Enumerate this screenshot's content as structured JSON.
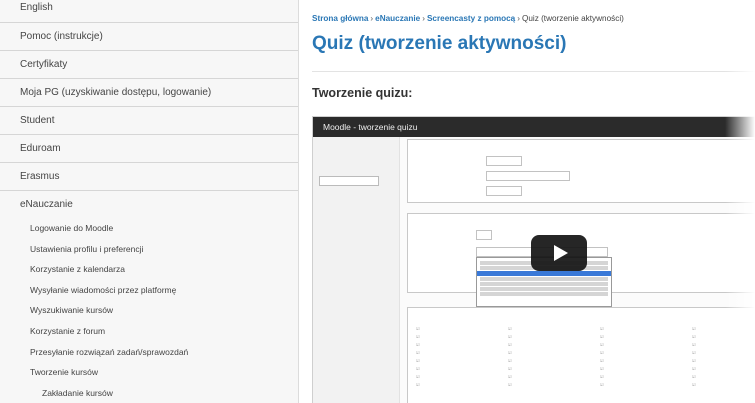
{
  "sidebar": {
    "items": [
      {
        "label": "English"
      },
      {
        "label": "Pomoc (instrukcje)"
      },
      {
        "label": "Certyfikaty"
      },
      {
        "label": "Moja PG (uzyskiwanie dostępu, logowanie)"
      },
      {
        "label": "Student"
      },
      {
        "label": "Eduroam"
      },
      {
        "label": "Erasmus"
      },
      {
        "label": "eNauczanie"
      }
    ],
    "subitems": [
      {
        "label": "Logowanie do Moodle"
      },
      {
        "label": "Ustawienia profilu i preferencji"
      },
      {
        "label": "Korzystanie z kalendarza"
      },
      {
        "label": "Wysyłanie wiadomości przez platformę"
      },
      {
        "label": "Wyszukiwanie kursów"
      },
      {
        "label": "Korzystanie z forum"
      },
      {
        "label": "Przesyłanie rozwiązań zadań/sprawozdań"
      },
      {
        "label": "Tworzenie kursów"
      },
      {
        "label": "Zakładanie kursów"
      }
    ]
  },
  "breadcrumb": {
    "home": "Strona główna",
    "enauczanie": "eNauczanie",
    "screencasty": "Screencasty z pomocą",
    "current": "Quiz (tworzenie aktywności)",
    "separator": "›"
  },
  "page": {
    "title": "Quiz (tworzenie aktywności)",
    "section_title": "Tworzenie quizu:"
  },
  "video": {
    "title": "Moodle - tworzenie quizu"
  },
  "colors": {
    "link": "#2a77b5",
    "video_bar": "#2b2b2b",
    "play_button": "#141414"
  }
}
